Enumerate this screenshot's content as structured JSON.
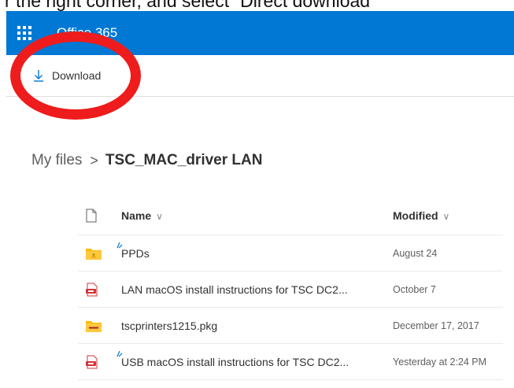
{
  "caption": "r the right corner, and select “Direct download”",
  "topbar": {
    "app_title": "Office 365"
  },
  "commandbar": {
    "download_label": "Download"
  },
  "breadcrumb": {
    "root": "My files",
    "separator": ">",
    "current": "TSC_MAC_driver LAN"
  },
  "columns": {
    "name": "Name",
    "modified": "Modified"
  },
  "files": [
    {
      "name": "PPDs",
      "modified": "August 24",
      "icon": "shared-folder-icon",
      "new": true
    },
    {
      "name": "LAN macOS install instructions for TSC DC2...",
      "modified": "October 7",
      "icon": "pdf-file-icon",
      "new": false
    },
    {
      "name": "tscprinters1215.pkg",
      "modified": "December 17, 2017",
      "icon": "package-file-icon",
      "new": false
    },
    {
      "name": "USB macOS install instructions for TSC DC2...",
      "modified": "Yesterday at 2:24 PM",
      "icon": "pdf-file-icon",
      "new": true
    }
  ],
  "colors": {
    "topbar": "#0078d4",
    "highlight_oval": "#ee1c1c",
    "folder": "#ffb900",
    "pdf": "#d13438"
  }
}
